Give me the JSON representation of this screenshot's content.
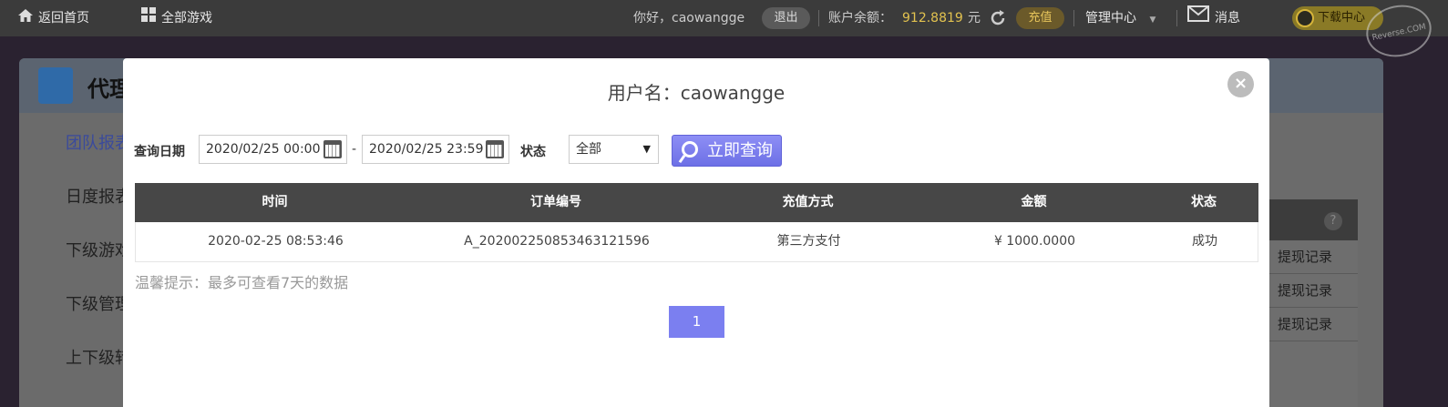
{
  "topbar": {
    "home": "返回首页",
    "all_games": "全部游戏",
    "greeting": "你好，caowangge",
    "logout": "退出",
    "balance_label": "账户余额：",
    "balance_value": "912.8819",
    "balance_unit": "元",
    "recharge": "充值",
    "admin_center": "管理中心",
    "messages": "消息",
    "download": "下载中心",
    "watermark": "Reverse.COM"
  },
  "background": {
    "title": "代理",
    "menu": [
      "团队报表",
      "日度报表",
      "下级游戏",
      "下级管理",
      "上下级转"
    ],
    "right_help": "?",
    "right_links": [
      "提现记录",
      "提现记录",
      "提现记录"
    ]
  },
  "modal": {
    "title": "用户名：caowangge",
    "close": "×",
    "query_date_label": "查询日期",
    "date_from": "2020/02/25 00:00",
    "date_sep": "-",
    "date_to": "2020/02/25 23:59",
    "status_label": "状态",
    "status_selected": "全部",
    "query_button": "立即查询",
    "columns": [
      "时间",
      "订单编号",
      "充值方式",
      "金额",
      "状态"
    ],
    "rows": [
      [
        "2020-02-25 08:53:46",
        "A_20200225085346312159​6",
        "第三方支付",
        "¥ 1000.0000",
        "成功"
      ]
    ],
    "tip": "温馨提示：最多可查看7天的数据",
    "pages": [
      "1"
    ]
  },
  "colors": {
    "accent": "#7b7ff0",
    "table_header": "#474747",
    "gold": "#e2c24f"
  }
}
